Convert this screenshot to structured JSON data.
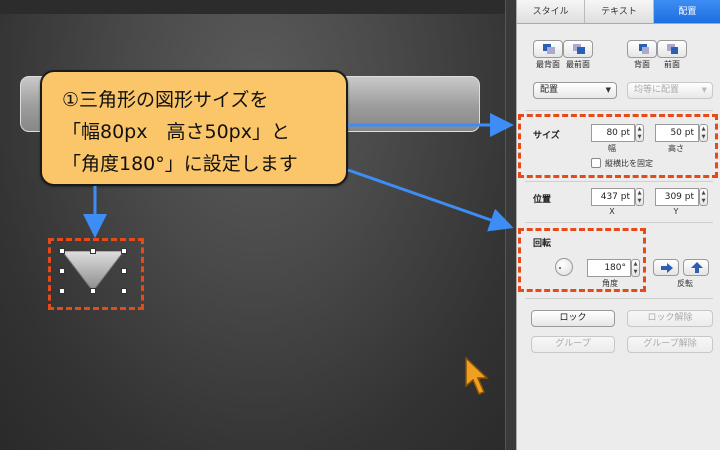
{
  "callout": {
    "line1": "①三角形の図形サイズを",
    "line2": "「幅80px　高さ50px」と",
    "line3": "「角度180°」に設定します"
  },
  "colors": {
    "highlight": "#e64a19",
    "arrow": "#3d8df5",
    "callout_bg": "#fbc66a",
    "active_tab": "#1e6fe0",
    "cursor": "#f0a020"
  },
  "inspector": {
    "tabs": [
      {
        "label": "スタイル",
        "active": false
      },
      {
        "label": "テキスト",
        "active": false
      },
      {
        "label": "配置",
        "active": true
      }
    ],
    "order_buttons": [
      {
        "label": "最背面",
        "icon": "send-to-back-icon"
      },
      {
        "label": "最前面",
        "icon": "bring-to-front-icon"
      },
      {
        "label": "背面",
        "icon": "send-backward-icon"
      },
      {
        "label": "前面",
        "icon": "bring-forward-icon"
      }
    ],
    "align_popup": "配置",
    "distribute_popup": "均等に配置",
    "size": {
      "label": "サイズ",
      "width_value": "80 pt",
      "height_value": "50 pt",
      "width_label": "幅",
      "height_label": "高さ",
      "constrain_label": "縦横比を固定"
    },
    "position": {
      "label": "位置",
      "x_value": "437 pt",
      "y_value": "309 pt",
      "x_label": "X",
      "y_label": "Y"
    },
    "rotate": {
      "label": "回転",
      "angle_value": "180°",
      "angle_label": "角度",
      "flip_label": "反転"
    },
    "lock_button": "ロック",
    "unlock_button": "ロック解除",
    "group_button": "グループ",
    "ungroup_button": "グループ解除"
  }
}
